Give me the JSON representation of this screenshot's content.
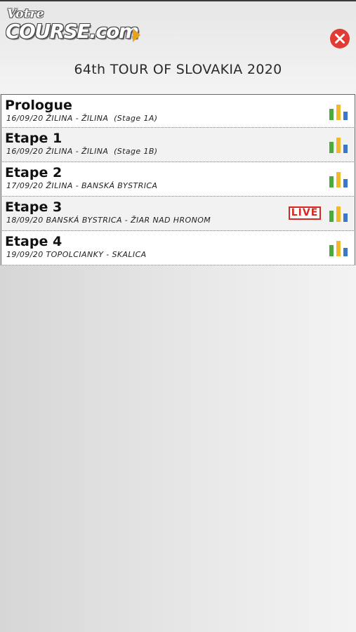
{
  "header": {
    "logo_top": "Votre",
    "logo_main": "COURSE.com",
    "title": "64th TOUR OF SLOVAKIA 2020"
  },
  "colors": {
    "accent_orange": "#e8a21b",
    "close_red": "#e23a35",
    "live_red": "#d42a23",
    "chart_green": "#4caa3c",
    "chart_yellow": "#f0b82a",
    "chart_blue": "#3c78c8"
  },
  "icons": {
    "close": "close-icon",
    "stats": "bar-chart-icon"
  },
  "stages": [
    {
      "name": "Prologue",
      "sub": "16/09/20 ŽILINA - ŽILINA  (Stage 1A)",
      "live": ""
    },
    {
      "name": "Etape 1",
      "sub": "16/09/20 ŽILINA - ŽILINA  (Stage 1B)",
      "live": ""
    },
    {
      "name": "Etape 2",
      "sub": "17/09/20 ŽILINA - BANSKÁ BYSTRICA",
      "live": ""
    },
    {
      "name": "Etape 3",
      "sub": "18/09/20 BANSKÁ BYSTRICA - ŽIAR NAD HRONOM",
      "live": "LIVE"
    },
    {
      "name": "Etape 4",
      "sub": "19/09/20 TOPOLCIANKY - SKALICA",
      "live": ""
    }
  ]
}
